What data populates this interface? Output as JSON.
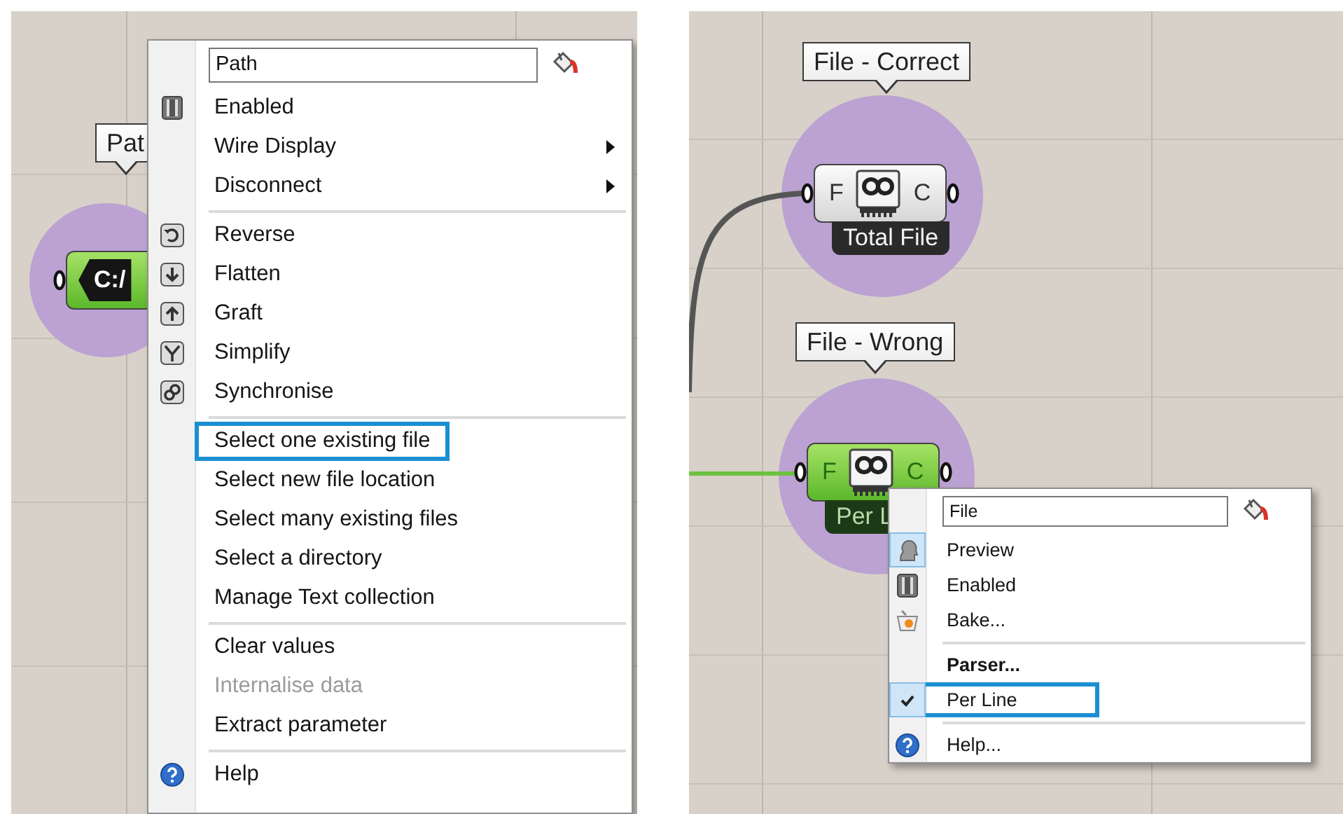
{
  "panels": [
    {
      "nodes": [
        {
          "kind": "param",
          "bubble": "Pat",
          "tag": "C:/",
          "selected": true
        }
      ],
      "menu": {
        "name": "Path",
        "items": [
          {
            "kind": "item",
            "label": "Enabled",
            "submenu": false,
            "checked": false,
            "disabled": false,
            "bold": false,
            "outlined": false
          },
          {
            "kind": "item",
            "label": "Wire Display",
            "submenu": true,
            "checked": false,
            "disabled": false,
            "bold": false,
            "outlined": false
          },
          {
            "kind": "item",
            "label": "Disconnect",
            "submenu": true,
            "checked": false,
            "disabled": false,
            "bold": false,
            "outlined": false
          },
          {
            "kind": "separator"
          },
          {
            "kind": "item",
            "label": "Reverse",
            "submenu": false,
            "checked": false,
            "disabled": false,
            "bold": false,
            "outlined": false
          },
          {
            "kind": "item",
            "label": "Flatten",
            "submenu": false,
            "checked": false,
            "disabled": false,
            "bold": false,
            "outlined": false
          },
          {
            "kind": "item",
            "label": "Graft",
            "submenu": false,
            "checked": false,
            "disabled": false,
            "bold": false,
            "outlined": false
          },
          {
            "kind": "item",
            "label": "Simplify",
            "submenu": false,
            "checked": false,
            "disabled": false,
            "bold": false,
            "outlined": false
          },
          {
            "kind": "item",
            "label": "Synchronise",
            "submenu": false,
            "checked": false,
            "disabled": false,
            "bold": false,
            "outlined": false
          },
          {
            "kind": "separator"
          },
          {
            "kind": "item",
            "label": "Select one existing file",
            "submenu": false,
            "checked": false,
            "disabled": false,
            "bold": false,
            "outlined": true
          },
          {
            "kind": "item",
            "label": "Select new file location",
            "submenu": false,
            "checked": false,
            "disabled": false,
            "bold": false,
            "outlined": false
          },
          {
            "kind": "item",
            "label": "Select many existing files",
            "submenu": false,
            "checked": false,
            "disabled": false,
            "bold": false,
            "outlined": false
          },
          {
            "kind": "item",
            "label": "Select a directory",
            "submenu": false,
            "checked": false,
            "disabled": false,
            "bold": false,
            "outlined": false
          },
          {
            "kind": "item",
            "label": "Manage Text collection",
            "submenu": false,
            "checked": false,
            "disabled": false,
            "bold": false,
            "outlined": false
          },
          {
            "kind": "separator"
          },
          {
            "kind": "item",
            "label": "Clear values",
            "submenu": false,
            "checked": false,
            "disabled": false,
            "bold": false,
            "outlined": false
          },
          {
            "kind": "item",
            "label": "Internalise data",
            "submenu": false,
            "checked": false,
            "disabled": true,
            "bold": false,
            "outlined": false
          },
          {
            "kind": "item",
            "label": "Extract parameter",
            "submenu": false,
            "checked": false,
            "disabled": false,
            "bold": false,
            "outlined": false
          },
          {
            "kind": "separator"
          },
          {
            "kind": "item",
            "label": "Help",
            "submenu": false,
            "checked": false,
            "disabled": false,
            "bold": false,
            "outlined": false
          }
        ]
      }
    },
    {
      "nodes": [
        {
          "kind": "reader",
          "bubble": "File - Correct",
          "input": "F",
          "output": "C",
          "name": "Total File",
          "selected": false
        },
        {
          "kind": "reader",
          "bubble": "File - Wrong",
          "input": "F",
          "output": "C",
          "name": "Per L",
          "selected": true
        }
      ],
      "menu": {
        "name": "File",
        "items": [
          {
            "kind": "item",
            "label": "Preview",
            "submenu": false,
            "checked": true,
            "disabled": false,
            "bold": false,
            "outlined": false
          },
          {
            "kind": "item",
            "label": "Enabled",
            "submenu": false,
            "checked": false,
            "disabled": false,
            "bold": false,
            "outlined": false
          },
          {
            "kind": "item",
            "label": "Bake...",
            "submenu": false,
            "checked": false,
            "disabled": false,
            "bold": false,
            "outlined": false
          },
          {
            "kind": "separator"
          },
          {
            "kind": "item",
            "label": "Parser...",
            "submenu": false,
            "checked": false,
            "disabled": false,
            "bold": true,
            "outlined": false
          },
          {
            "kind": "item",
            "label": "Per Line",
            "submenu": false,
            "checked": true,
            "disabled": false,
            "bold": false,
            "outlined": true
          },
          {
            "kind": "separator"
          },
          {
            "kind": "item",
            "label": "Help...",
            "submenu": false,
            "checked": false,
            "disabled": false,
            "bold": false,
            "outlined": false
          }
        ]
      }
    }
  ]
}
